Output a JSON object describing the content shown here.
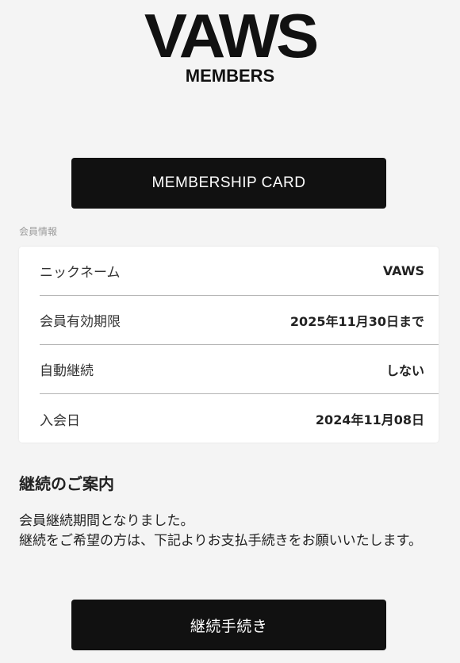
{
  "logo": {
    "main": "VAWS",
    "sub": "MEMBERS"
  },
  "membership_card_button": "MEMBERSHIP CARD",
  "member_info": {
    "section_label": "会員情報",
    "rows": [
      {
        "label": "ニックネーム",
        "value": "VAWS"
      },
      {
        "label": "会員有効期限",
        "value": "2025年11月30日まで"
      },
      {
        "label": "自動継続",
        "value": "しない"
      },
      {
        "label": "入会日",
        "value": "2024年11月08日"
      }
    ]
  },
  "renewal": {
    "heading": "継続のご案内",
    "line1": "会員継続期間となりました。",
    "line2": "継続をご希望の方は、下記よりお支払手続きをお願いいたします。",
    "button": "継続手続き"
  }
}
